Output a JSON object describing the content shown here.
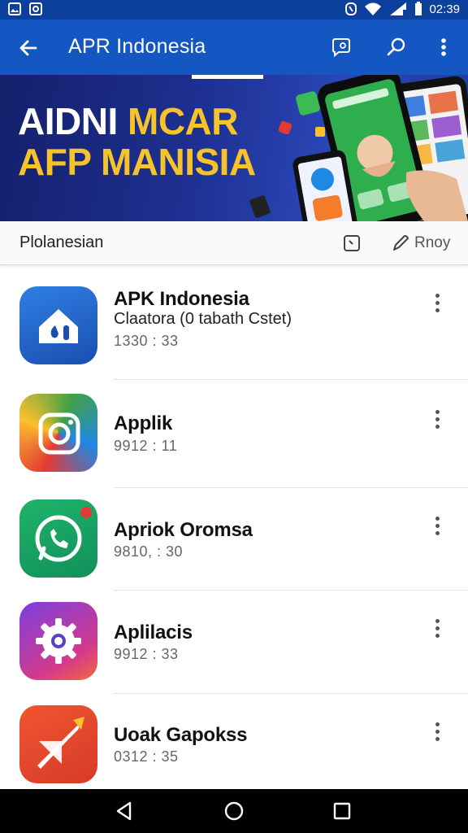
{
  "status_bar": {
    "time": "02:39",
    "icons": [
      "image-icon",
      "app-icon",
      "nfc-icon",
      "wifi-icon",
      "signal-icon",
      "battery-icon"
    ]
  },
  "app_bar": {
    "title": "APR Indonesia",
    "icons": [
      "back-arrow-icon",
      "chat-icon",
      "search-icon",
      "more-vert-icon"
    ]
  },
  "banner": {
    "line1_white": "AIDNI ",
    "line1_yellow": "MCAR",
    "line2": "AFP MANISIA"
  },
  "filter_row": {
    "label": "Plolanesian",
    "action": "Rnoy"
  },
  "apps": [
    {
      "name": "APK Indonesia",
      "subtitle": "Claatora (0 tabath Cstet)",
      "meta": "1330 : 33"
    },
    {
      "name": "Applik",
      "subtitle": "",
      "meta": "9912 : 11"
    },
    {
      "name": "Apriok Oromsa",
      "subtitle": "",
      "meta": "9810, : 30"
    },
    {
      "name": "Aplilacis",
      "subtitle": "",
      "meta": "9912 : 33"
    },
    {
      "name": "Uoak Gapokss",
      "subtitle": "",
      "meta": "0312 : 35"
    }
  ],
  "colors": {
    "status_bar": "#0d3f9c",
    "app_bar": "#1456c2",
    "banner_yellow": "#f5c32c"
  },
  "nav_bar": {
    "icons": [
      "back-triangle-icon",
      "home-circle-icon",
      "recents-square-icon"
    ]
  }
}
